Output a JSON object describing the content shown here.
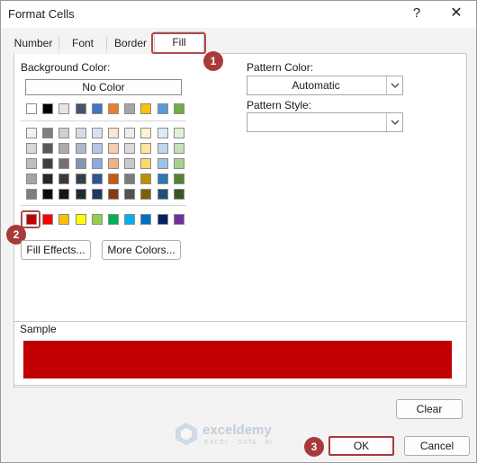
{
  "window": {
    "title": "Format Cells",
    "help_label": "?",
    "close_label": "✕"
  },
  "tabs": [
    {
      "label": "Number",
      "selected": false
    },
    {
      "label": "Font",
      "selected": false
    },
    {
      "label": "Border",
      "selected": false
    },
    {
      "label": "Fill",
      "selected": true
    }
  ],
  "fill": {
    "background_color_label": "Background Color:",
    "no_color_label": "No Color",
    "selected_color": "#c00000",
    "fill_effects_label": "Fill Effects...",
    "more_colors_label": "More Colors...",
    "pattern_color_label": "Pattern Color:",
    "pattern_color_value": "Automatic",
    "pattern_style_label": "Pattern Style:",
    "pattern_style_value": ""
  },
  "palette": {
    "theme_top": [
      "#ffffff",
      "#000000",
      "#e7e6e6",
      "#44546a",
      "#4472c4",
      "#ed7d31",
      "#a5a5a5",
      "#ffc000",
      "#5b9bd5",
      "#70ad47"
    ],
    "theme_shades": [
      [
        "#f2f2f2",
        "#7f7f7f",
        "#d0cece",
        "#d6dce4",
        "#d9e2f3",
        "#fbe5d5",
        "#ededed",
        "#fff2cc",
        "#deebf6",
        "#e2efd9"
      ],
      [
        "#d8d8d8",
        "#595959",
        "#aeabab",
        "#adb9ca",
        "#b4c6e7",
        "#f7cbac",
        "#dbdbdb",
        "#fee599",
        "#bdd7ee",
        "#c5e0b3"
      ],
      [
        "#bfbfbf",
        "#3f3f3f",
        "#757070",
        "#8496b0",
        "#8eaadb",
        "#f4b183",
        "#c9c9c9",
        "#ffd965",
        "#9cc3e5",
        "#a8d08d"
      ],
      [
        "#a5a5a5",
        "#262626",
        "#3a3838",
        "#323f4f",
        "#2f5496",
        "#c55a11",
        "#7b7b7b",
        "#bf9000",
        "#2e75b5",
        "#538135"
      ],
      [
        "#7f7f7f",
        "#0c0c0c",
        "#171616",
        "#222a35",
        "#1f3864",
        "#833c0b",
        "#525252",
        "#7f6000",
        "#1e4e79",
        "#375623"
      ]
    ],
    "standard": [
      "#c00000",
      "#ff0000",
      "#ffc000",
      "#ffff00",
      "#92d050",
      "#00b050",
      "#00b0f0",
      "#0070c0",
      "#002060",
      "#7030a0"
    ]
  },
  "sample": {
    "label": "Sample"
  },
  "buttons": {
    "clear_label": "Clear",
    "ok_label": "OK",
    "cancel_label": "Cancel"
  },
  "callouts": {
    "step1": "1",
    "step2": "2",
    "step3": "3"
  },
  "watermark": {
    "name": "exceldemy",
    "tagline": "EXCEL · DATA · BI"
  }
}
